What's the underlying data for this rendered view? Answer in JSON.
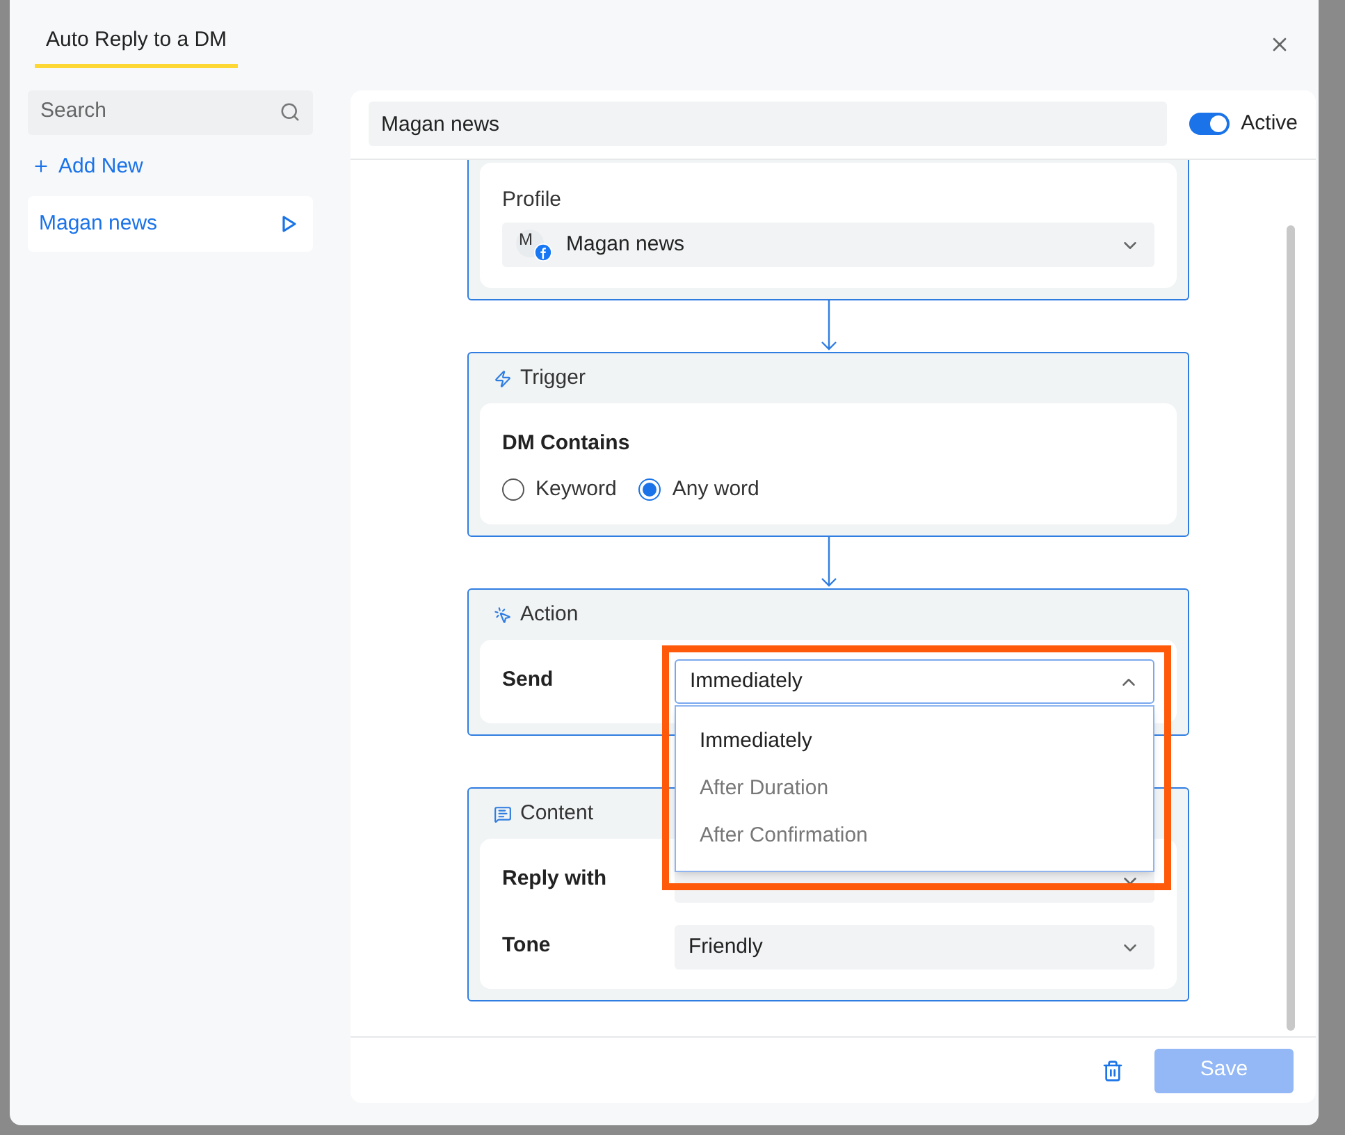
{
  "dialog": {
    "title": "Auto Reply to a DM"
  },
  "sidebar": {
    "search": {
      "placeholder": "Search"
    },
    "add_new": "Add New",
    "items": [
      {
        "label": "Magan news",
        "selected": true
      }
    ]
  },
  "editor": {
    "name": "Magan news",
    "active": {
      "label": "Active",
      "on": true
    },
    "steps": [
      {
        "kind": "profile",
        "label": "Profile",
        "avatar_initial": "M",
        "value": "Magan news"
      },
      {
        "kind": "trigger",
        "title": "Trigger",
        "question": "DM Contains",
        "options": [
          {
            "label": "Keyword",
            "selected": false
          },
          {
            "label": "Any word",
            "selected": true
          }
        ]
      },
      {
        "kind": "action",
        "title": "Action",
        "rows": [
          {
            "label": "Send",
            "value": "Immediately",
            "expanded": true,
            "highlighted": true,
            "options": [
              {
                "label": "Immediately",
                "selected": true
              },
              {
                "label": "After Duration",
                "selected": false
              },
              {
                "label": "After Confirmation",
                "selected": false
              }
            ]
          }
        ]
      },
      {
        "kind": "content",
        "title": "Content",
        "rows": [
          {
            "label": "Reply with",
            "expanded": false
          },
          {
            "label": "Tone",
            "value": "Friendly",
            "expanded": false
          }
        ]
      }
    ]
  },
  "footer": {
    "save": {
      "label": "Save",
      "disabled": true
    }
  }
}
